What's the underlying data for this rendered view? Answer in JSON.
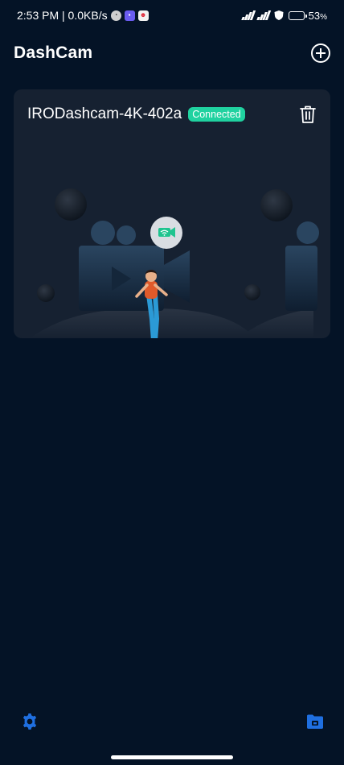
{
  "status_bar": {
    "time_speed": "2:53 PM | 0.0KB/s",
    "battery_percent": "53",
    "battery_unit": "%",
    "battery_level": 0.53,
    "icons": [
      "clock-icon",
      "message-icon",
      "bot-icon",
      "signal-icon",
      "shield-icon",
      "battery-icon"
    ]
  },
  "header": {
    "title": "DashCam",
    "add_icon": "add-circle-icon"
  },
  "device_card": {
    "name": "IRODashcam-4K-402a",
    "status": "Connected",
    "delete_icon": "trash-icon"
  },
  "bottom_nav": {
    "settings_icon": "gear-icon",
    "files_icon": "folder-icon"
  },
  "colors": {
    "background": "#041326",
    "card": "#162131",
    "connected": "#20d2a0",
    "accent": "#1f6fe0"
  }
}
